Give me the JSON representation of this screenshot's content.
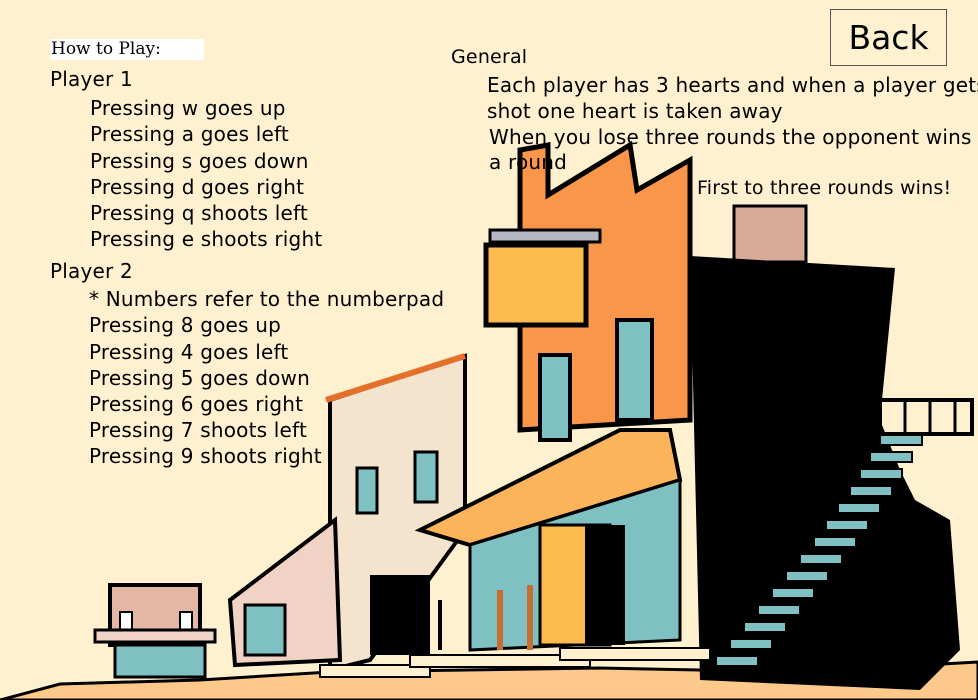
{
  "screen": {
    "title": "How to Play:",
    "back_label": "Back"
  },
  "player1": {
    "heading": "Player 1",
    "lines": [
      "Pressing w goes up",
      "Pressing a goes left",
      "Pressing s goes down",
      "Pressing d goes right",
      "Pressing q shoots left",
      "Pressing e shoots right"
    ]
  },
  "player2": {
    "heading": "Player 2",
    "note": "* Numbers refer to the numberpad",
    "lines": [
      "Pressing 8 goes up",
      "Pressing 4 goes left",
      "Pressing 5 goes down",
      "Pressing 6 goes right",
      "Pressing 7 shoots left",
      "Pressing 9 shoots right"
    ]
  },
  "general": {
    "heading": "General",
    "line1a": "Each player has 3 hearts and when a player gets",
    "line1b": "shot one heart is taken away",
    "line2a": "When you lose three rounds the opponent wins",
    "line2b": "a round",
    "line3": "First to three rounds wins!"
  },
  "colors": {
    "background": "#fff1d0",
    "ground": "#fcc98a",
    "orange_building": "#f9964a",
    "awning": "#fbb45a",
    "sign": "#fdbb4f",
    "cream_building": "#f4e3cd",
    "pink_building": "#f0d3c4",
    "teal": "#7fc1c2",
    "black_building": "#000000"
  }
}
